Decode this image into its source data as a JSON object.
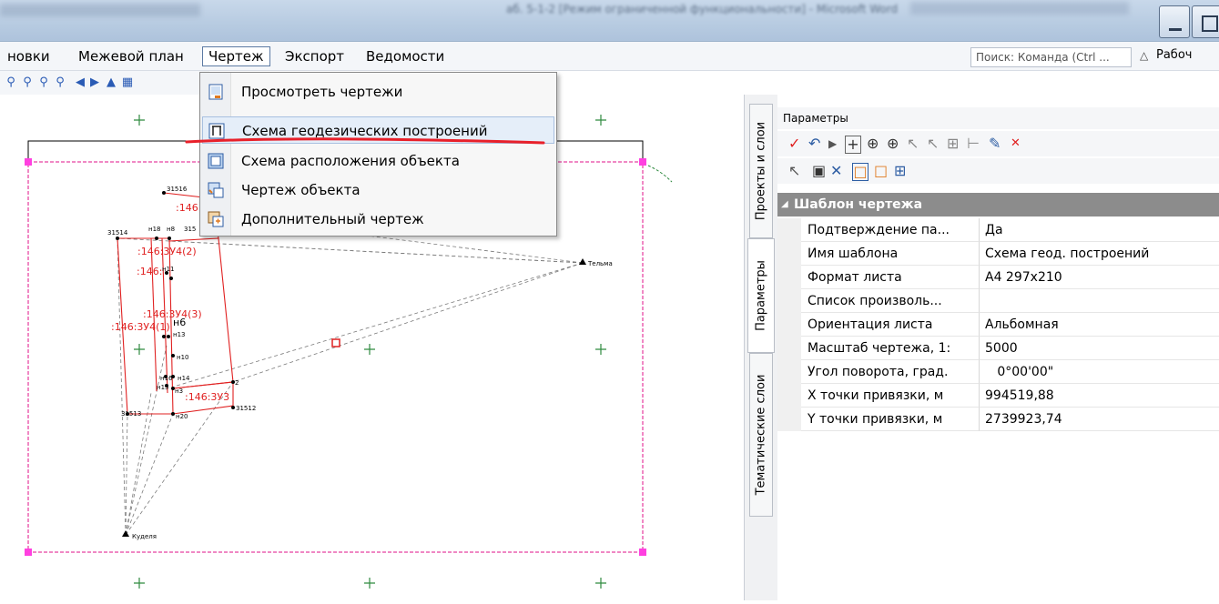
{
  "window": {
    "title": "аб. 5-1-2 [Режим ограниченной функциональности] - Microsoft Word"
  },
  "menubar": {
    "items": [
      "новки",
      "Межевой план",
      "Чертеж",
      "Экспорт",
      "Ведомости"
    ],
    "search_placeholder": "Поиск: Команда (Ctrl ...",
    "workbench": "Рабоч"
  },
  "dropdown": {
    "items": [
      {
        "label": "Просмотреть чертежи",
        "icon": "view-drawings-icon"
      },
      {
        "label": "Схема геодезических построений",
        "icon": "geodetic-scheme-icon"
      },
      {
        "label": "Схема расположения объекта",
        "icon": "location-scheme-icon"
      },
      {
        "label": "Чертеж объекта",
        "icon": "object-drawing-icon"
      },
      {
        "label": "Дополнительный чертеж",
        "icon": "additional-drawing-icon"
      }
    ],
    "highlight_color": "#e5eef9",
    "annotation_color": "#e8202a"
  },
  "sidetabs": [
    "Проекты и слои",
    "Параметры",
    "Тематические слои"
  ],
  "params": {
    "title": "Параметры",
    "section": "Шаблон чертежа",
    "rows": [
      {
        "key": "Подтверждение па...",
        "value": "Да"
      },
      {
        "key": "Имя шаблона",
        "value": "Схема геод. построений"
      },
      {
        "key": "Формат листа",
        "value": "А4 297x210"
      },
      {
        "key": "Список произволь...",
        "value": ""
      },
      {
        "key": "Ориентация листа",
        "value": "Альбомная"
      },
      {
        "key": "Масштаб чертежа, 1:",
        "value": "5000"
      },
      {
        "key": "Угол поворота, град.",
        "value": "   0°00'00\""
      },
      {
        "key": "X точки привязки, м",
        "value": "994519,88"
      },
      {
        "key": "Y точки привязки, м",
        "value": "2739923,74"
      }
    ]
  },
  "drawing": {
    "labels": {
      "p31516": "31516",
      "p31514": "31514",
      "h18": "н18",
      "h8": "н8",
      "p315": "315",
      "a146_top": ":146:",
      "a146_zu4_2": ":146:3У4(2)",
      "a146_2": ":146:",
      "h11": "н11",
      "a146_zu4_3": ":146:3У4(3)",
      "a146_zu4_1": ":146:3У4(1)",
      "h6": "н6",
      "h13": "н13",
      "h10": "н10",
      "h16": "н16",
      "h14": "н14",
      "h15": "н15",
      "h3": "н3",
      "a146_zu3": ":146:3У3",
      "n2": "2",
      "p31513": "31513",
      "h20": "н20",
      "p31512": "31512",
      "telma": "Тельма",
      "kudelya": "Куделя"
    },
    "line_color": "#e02020",
    "frame_color": "#ff2bd6"
  }
}
